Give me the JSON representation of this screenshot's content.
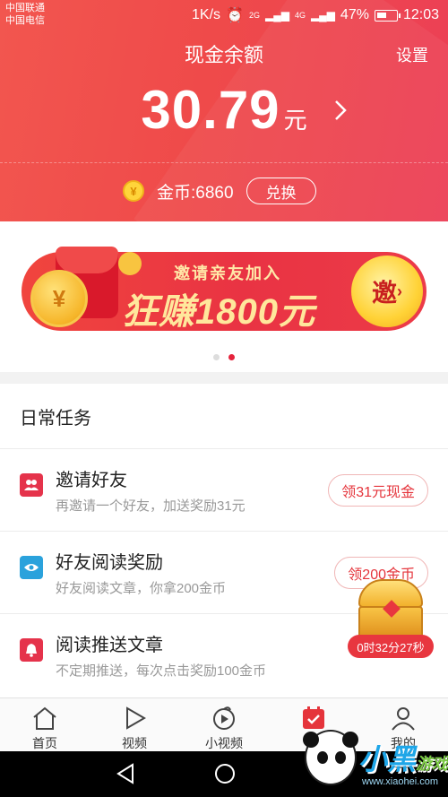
{
  "status_bar": {
    "carrier_1": "中国联通",
    "carrier_2": "中国电信",
    "speed": "1K/s",
    "network_1": "2G",
    "network_2": "4G",
    "battery": "47%",
    "time": "12:03"
  },
  "header": {
    "title": "现金余额",
    "settings_label": "设置",
    "balance_amount": "30.79",
    "balance_unit": "元",
    "coin_label": "金币:6860",
    "exchange_label": "兑换"
  },
  "banner": {
    "top_text": "邀请亲友加入",
    "main_text": "狂赚1800元",
    "button_text": "邀",
    "active_slide": 2,
    "slides": 2
  },
  "tasks": {
    "heading": "日常任务",
    "items": [
      {
        "title": "邀请好友",
        "subtitle": "再邀请一个好友，加送奖励31元",
        "button": "领31元现金",
        "icon": "users-icon",
        "color": "#e5334b"
      },
      {
        "title": "好友阅读奖励",
        "subtitle": "好友阅读文章，你拿200金币",
        "button": "领200金币",
        "icon": "eye-icon",
        "color": "#2aa2dc"
      },
      {
        "title": "阅读推送文章",
        "subtitle": "不定期推送，每次点击奖励100金币",
        "button": "",
        "icon": "bell-icon",
        "color": "#e5334b"
      }
    ]
  },
  "treasure": {
    "countdown": "0时32分27秒"
  },
  "tabbar": {
    "items": [
      {
        "label": "首页",
        "icon": "home-icon"
      },
      {
        "label": "视频",
        "icon": "play-icon"
      },
      {
        "label": "小视频",
        "icon": "short-video-icon"
      },
      {
        "label": "",
        "icon": "calendar-icon",
        "active": true
      },
      {
        "label": "我的",
        "icon": "profile-icon"
      }
    ]
  },
  "watermark": {
    "logo_text": "小黑",
    "logo_sub": "游戏",
    "url": "www.xiaohei.com"
  },
  "colors": {
    "accent": "#e5343b",
    "header_bg": "#ef4a4a",
    "coin": "#ffd43a"
  }
}
